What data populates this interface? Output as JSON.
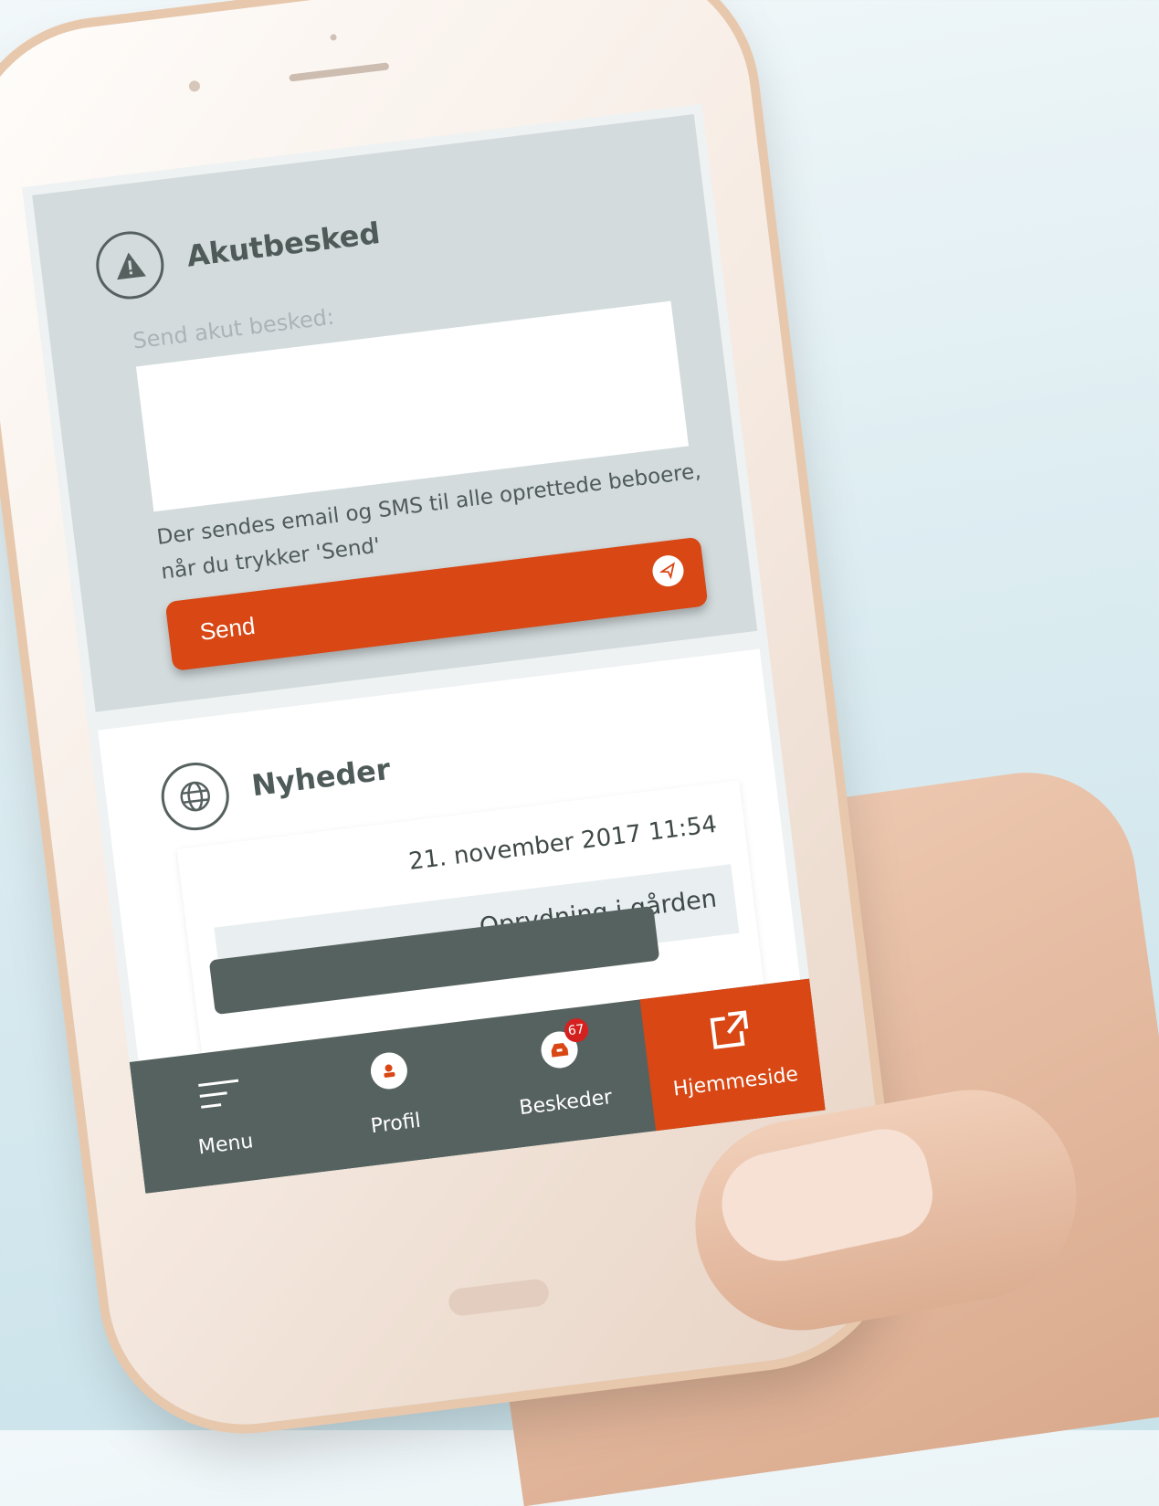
{
  "alert_card": {
    "title": "Akutbesked",
    "field_label": "Send akut besked:",
    "message_value": "",
    "hint": "Der sendes email og SMS til alle oprettede beboere, når du trykker 'Send'",
    "send_label": "Send",
    "icon": "warning-icon",
    "send_icon": "paper-plane-icon"
  },
  "news_card": {
    "title": "Nyheder",
    "icon": "globe-icon",
    "items": [
      {
        "date": "21. november 2017 11:54",
        "headline": "Oprydning i gården"
      }
    ]
  },
  "bottom_nav": {
    "items": [
      {
        "label": "Menu",
        "icon": "menu-icon"
      },
      {
        "label": "Profil",
        "icon": "user-icon"
      },
      {
        "label": "Beskeder",
        "icon": "inbox-icon",
        "badge": "67"
      },
      {
        "label": "Hjemmeside",
        "icon": "external-link-icon",
        "active": true
      }
    ]
  },
  "colors": {
    "accent": "#d84714",
    "dark": "#56625f",
    "card_gray": "#d3dbdd",
    "badge": "#d52020"
  }
}
